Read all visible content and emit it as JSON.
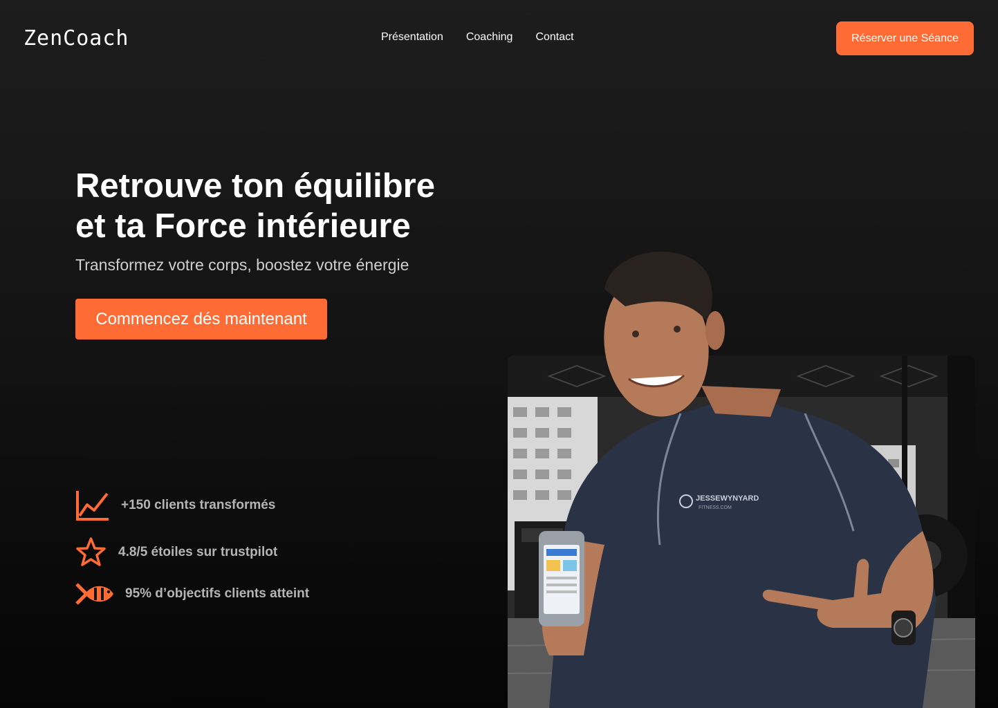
{
  "header": {
    "logo": "ZenCoach",
    "nav": [
      "Présentation",
      "Coaching",
      "Contact"
    ],
    "cta_label": "Réserver une Séance"
  },
  "hero": {
    "title_line1": "Retrouve ton équilibre",
    "title_line2": "et ta Force intérieure",
    "subtitle": "Transformez votre corps, boostez votre énergie",
    "cta_label": "Commencez dés maintenant"
  },
  "stats": [
    {
      "icon": "chart-line-icon",
      "text": "+150 clients transformés"
    },
    {
      "icon": "star-icon",
      "text": "4.8/5 étoiles sur trustpilot"
    },
    {
      "icon": "fish-icon",
      "text": "95% d’objectifs clients atteint"
    }
  ],
  "image": {
    "shirt_brand": "JESSEWYNYARD",
    "shirt_sub": "FITNESS.COM"
  },
  "colors": {
    "accent": "#ff6b35",
    "background": "#141414",
    "stat_text": "#b5b5b5"
  }
}
